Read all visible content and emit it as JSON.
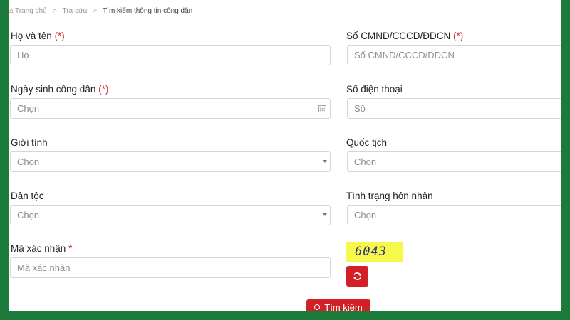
{
  "breadcrumb": {
    "items": [
      "Trang chủ",
      "Tra cứu",
      "Tìm kiếm thông tin công dân"
    ],
    "separator": ">"
  },
  "form": {
    "full_name": {
      "label": "Họ và tên",
      "required_mark": "(*)",
      "placeholder": "Họ"
    },
    "id_number": {
      "label": "Số CMND/CCCD/ĐDCN",
      "required_mark": "(*)",
      "placeholder": "Số CMND/CCCD/ĐDCN"
    },
    "birth_date": {
      "label": "Ngày sinh công dân",
      "required_mark": "(*)",
      "placeholder": "Chọn"
    },
    "phone": {
      "label": "Số điện thoại",
      "placeholder": "Số"
    },
    "gender": {
      "label": "Giới tính",
      "selected": "Chọn"
    },
    "nationality": {
      "label": "Quốc tịch",
      "selected": "Chọn"
    },
    "ethnicity": {
      "label": "Dân tộc",
      "selected": "Chọn"
    },
    "marital_status": {
      "label": "Tình trạng hôn nhân",
      "selected": "Chọn"
    },
    "captcha": {
      "label": "Mã xác nhận",
      "required_mark": "*",
      "placeholder": "Mã xác nhận",
      "code": "6043"
    }
  },
  "actions": {
    "search_label": "Tìm kiếm"
  },
  "colors": {
    "frame_background": "#1c7a3a",
    "accent": "#d32027",
    "required": "#d32f2f",
    "captcha_background": "#f6f94a"
  }
}
